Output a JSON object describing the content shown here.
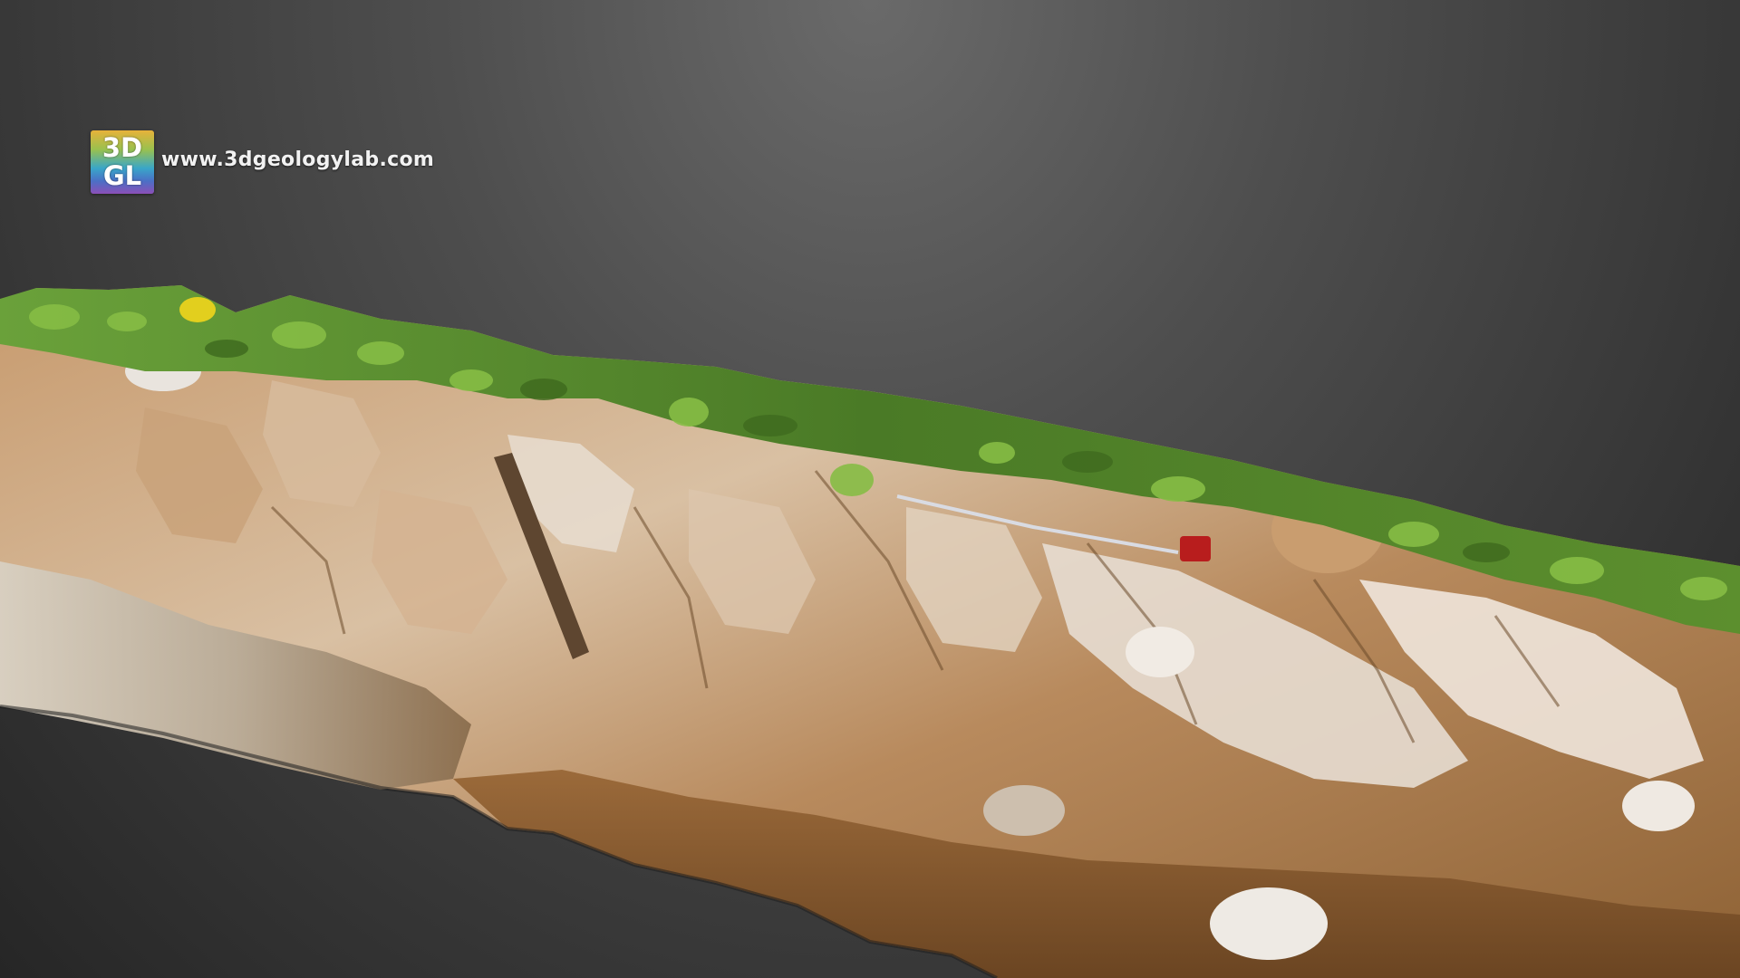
{
  "viewer": {
    "background_top": "#6a6a6a",
    "background_bottom": "#262626"
  },
  "watermark": {
    "logo_line1": "3D",
    "logo_line2": "GL",
    "url": "www.3dgeologylab.com"
  },
  "model": {
    "subject": "rock-outcrop-3d-model",
    "colors": {
      "vegetation": "#4f7f2a",
      "vegetation_light": "#8bbd4a",
      "rock_light": "#e6d8c8",
      "rock_tan": "#b5865a",
      "soil": "#8a5a2e",
      "water": "#cfc7b8"
    }
  }
}
